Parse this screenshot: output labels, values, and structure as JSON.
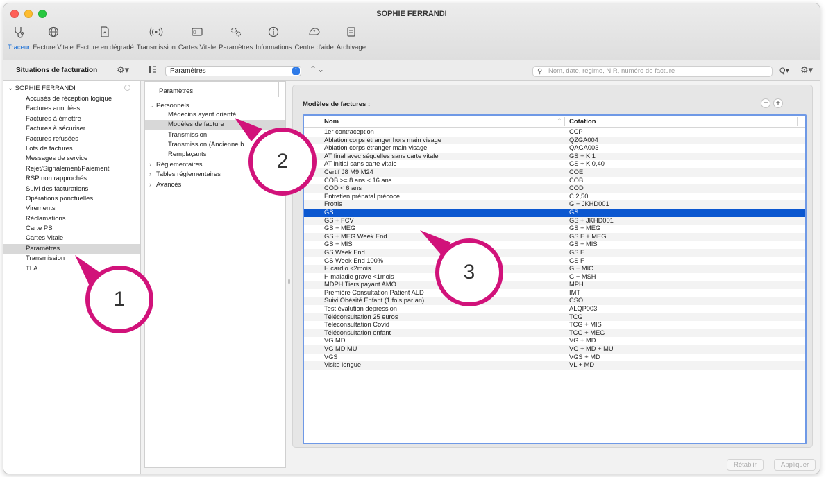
{
  "window": {
    "title": "SOPHIE FERRANDI",
    "traffic_colors": [
      "#ff5f57",
      "#febc2e",
      "#28c840"
    ]
  },
  "toolbar": {
    "items": [
      {
        "label": "Traceur",
        "icon": "stethoscope-icon",
        "active": true
      },
      {
        "label": "Facture Vitale",
        "icon": "globe-icon"
      },
      {
        "label": "Facture en dégradé",
        "icon": "document-icon"
      },
      {
        "label": "Transmission",
        "icon": "broadcast-icon"
      },
      {
        "label": "Cartes Vitale",
        "icon": "card-icon"
      },
      {
        "label": "Paramètres",
        "icon": "gears-icon"
      },
      {
        "label": "Informations",
        "icon": "info-icon"
      },
      {
        "label": "Centre d'aide",
        "icon": "help-icon"
      },
      {
        "label": "Archivage",
        "icon": "printer-icon"
      }
    ]
  },
  "subbar": {
    "title": "Situations de facturation",
    "select_value": "Paramètres",
    "search_placeholder": "Nom, date, régime, NIR, numéro de facture"
  },
  "left_panel": {
    "root": "SOPHIE FERRANDI",
    "items": [
      "Accusés de réception logique",
      "Factures annulées",
      "Factures à émettre",
      "Factures à sécuriser",
      "Factures refusées",
      "Lots de factures",
      "Messages de service",
      "Rejet/Signalement/Paiement",
      "RSP non rapprochés",
      "Suivi des facturations",
      "Opérations ponctuelles",
      "Virements",
      "Réclamations",
      "Carte PS",
      "Cartes Vitale",
      "Paramètres",
      "Transmission",
      "TLA"
    ],
    "selected_index": 15
  },
  "middle_panel": {
    "header": "Paramètres",
    "tree": [
      {
        "label": "Personnels",
        "level": 0,
        "chevron": "open"
      },
      {
        "label": "Médecins ayant orienté",
        "level": 1
      },
      {
        "label": "Modèles de facture",
        "level": 1,
        "selected": true
      },
      {
        "label": "Transmission",
        "level": 1
      },
      {
        "label": "Transmission (Ancienne b",
        "level": 1
      },
      {
        "label": "Remplaçants",
        "level": 1
      },
      {
        "label": "Réglementaires",
        "level": 0,
        "chevron": "closed"
      },
      {
        "label": "Tables réglementaires",
        "level": 0,
        "chevron": "closed"
      },
      {
        "label": "Avancés",
        "level": 0,
        "chevron": "closed"
      }
    ]
  },
  "models": {
    "title": "Modèles de factures :",
    "columns": [
      "Nom",
      "Cotation"
    ],
    "rows": [
      [
        "1er contraception",
        "CCP"
      ],
      [
        "Ablation corps étranger hors main visage",
        "QZGA004"
      ],
      [
        "Ablation corps étranger main visage",
        "QAGA003"
      ],
      [
        "AT final avec séquelles sans carte vitale",
        "GS + K 1"
      ],
      [
        "AT initial sans carte vitale",
        "GS + K 0,40"
      ],
      [
        "Certif J8 M9 M24",
        "COE"
      ],
      [
        "COB >= 8 ans < 16 ans",
        "COB"
      ],
      [
        "COD < 6 ans",
        "COD"
      ],
      [
        "Entretien prénatal précoce",
        "C 2,50"
      ],
      [
        "Frottis",
        "G + JKHD001"
      ],
      [
        "GS",
        "GS"
      ],
      [
        "GS + FCV",
        "GS + JKHD001"
      ],
      [
        "GS + MEG",
        "GS + MEG"
      ],
      [
        "GS + MEG Week End",
        "GS F + MEG"
      ],
      [
        "GS + MIS",
        "GS + MIS"
      ],
      [
        "GS Week End",
        "GS F"
      ],
      [
        "GS Week End 100%",
        "GS F"
      ],
      [
        "H cardio <2mois",
        "G + MIC"
      ],
      [
        "H maladie grave <1mois",
        "G + MSH"
      ],
      [
        "MDPH Tiers payant AMO",
        "MPH"
      ],
      [
        "Première Consultation Patient ALD",
        "IMT"
      ],
      [
        "Suivi Obésité Enfant (1 fois par an)",
        "CSO"
      ],
      [
        "Test évalution depression",
        "ALQP003"
      ],
      [
        "Téléconsultation 25 euros",
        "TCG"
      ],
      [
        "Téléconsultation Covid",
        "TCG + MIS"
      ],
      [
        "Téléconsultation enfant",
        "TCG + MEG"
      ],
      [
        "VG MD",
        "VG + MD"
      ],
      [
        "VG MD MU",
        "VG + MD + MU"
      ],
      [
        "VGS",
        "VGS + MD"
      ],
      [
        "Visite longue",
        "VL + MD"
      ]
    ],
    "selected_index": 10
  },
  "footer": {
    "retablir": "Rétablir",
    "appliquer": "Appliquer"
  },
  "callouts": [
    "1",
    "2",
    "3"
  ],
  "accent_color": "#d1127a",
  "selection_color": "#0b57d0"
}
